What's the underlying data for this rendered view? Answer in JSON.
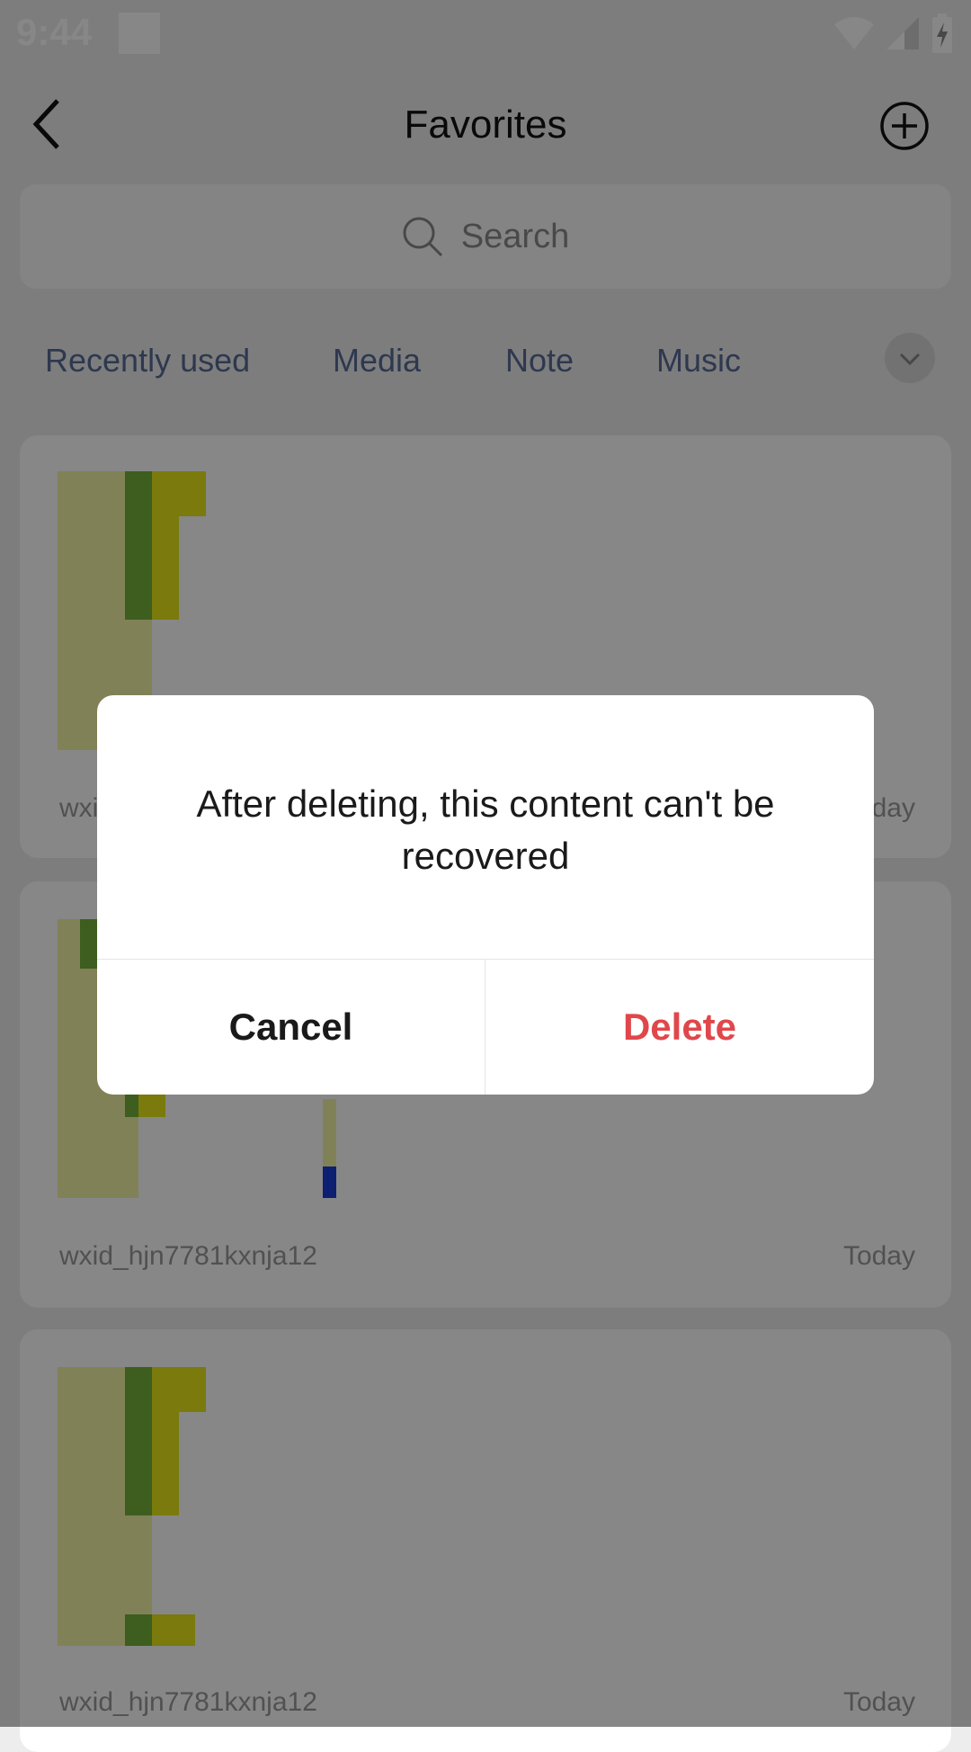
{
  "status_bar": {
    "time": "9:44"
  },
  "header": {
    "title": "Favorites",
    "back_icon": "chevron-left-icon",
    "add_icon": "plus-circle-icon"
  },
  "search": {
    "placeholder": "Search",
    "icon": "search-icon"
  },
  "tabs": {
    "items": [
      "Recently used",
      "Media",
      "Note",
      "Music"
    ],
    "expand_icon": "chevron-down-icon",
    "color": "#576b95"
  },
  "cards": [
    {
      "source": "wxid_hjn7781kxnja12",
      "date": "Today"
    },
    {
      "source": "wxid_hjn7781kxnja12",
      "date": "Today"
    },
    {
      "source": "wxid_hjn7781kxnja12",
      "date": "Today"
    }
  ],
  "dialog": {
    "message": "After deleting, this content can't be recovered",
    "cancel_label": "Cancel",
    "delete_label": "Delete",
    "delete_color": "#e0474b"
  }
}
